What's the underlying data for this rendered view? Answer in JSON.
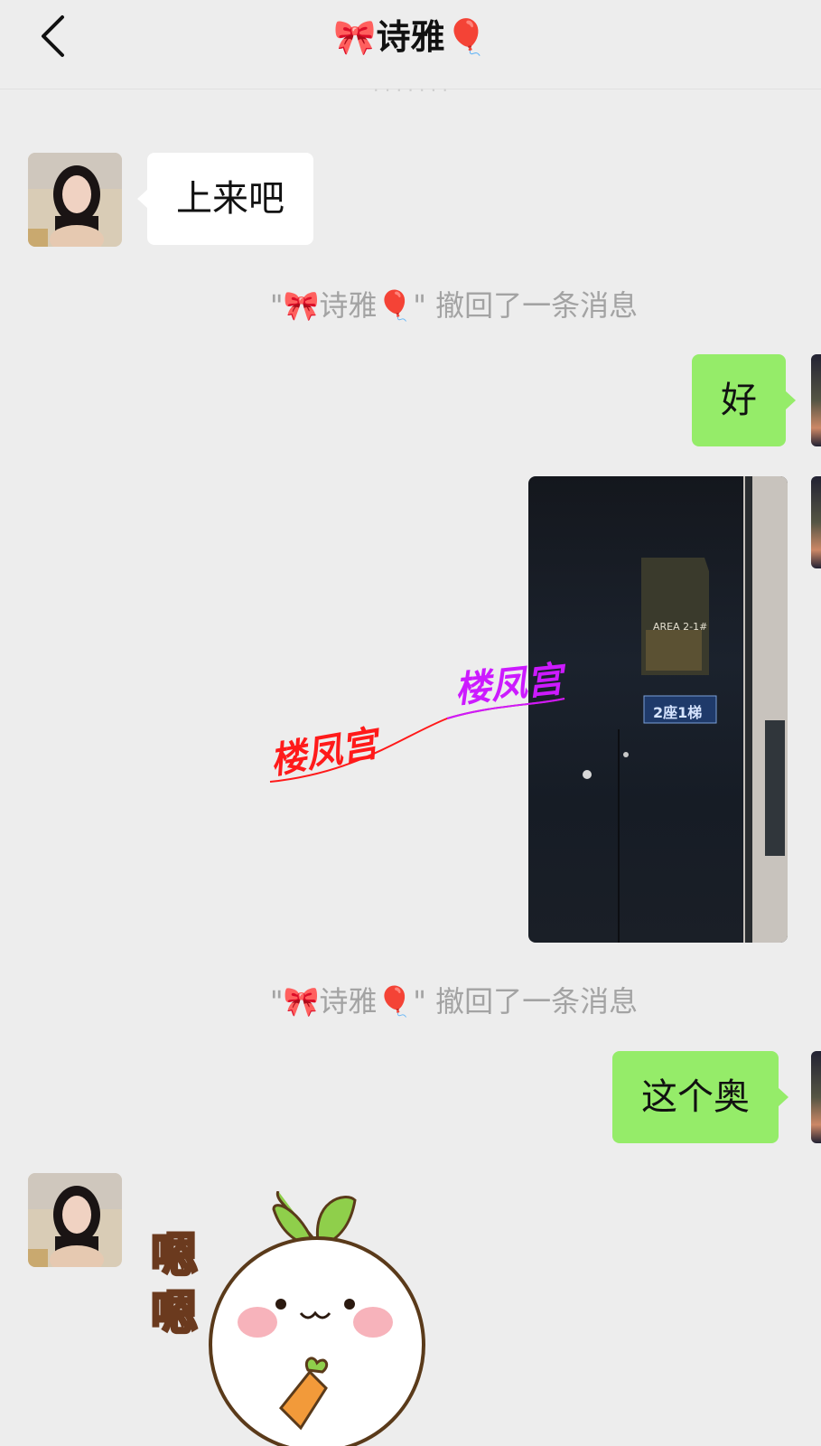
{
  "header": {
    "title": "🎀诗雅🎈",
    "subheader_partial": "· · · · · · ·"
  },
  "messages": [
    {
      "side": "left",
      "type": "text",
      "text": "上来吧"
    },
    {
      "type": "system",
      "text": "\"🎀诗雅🎈\" 撤回了一条消息"
    },
    {
      "side": "right",
      "type": "text",
      "text": "好"
    },
    {
      "side": "right",
      "type": "image",
      "sign_text": "AREA 2-1#",
      "plate_text": "2座1梯"
    },
    {
      "type": "system",
      "text": "\"🎀诗雅🎈\" 撤回了一条消息"
    },
    {
      "side": "right",
      "type": "text",
      "text": "这个奥"
    },
    {
      "side": "left",
      "type": "sticker",
      "text": "嗯嗯"
    }
  ],
  "watermark": {
    "text": "楼凤宫",
    "color_left": "#ff1a1a",
    "color_right": "#cc1aff"
  },
  "colors": {
    "background": "#ededed",
    "self_bubble": "#95ec69",
    "other_bubble": "#ffffff",
    "system_text": "#a3a3a3"
  }
}
